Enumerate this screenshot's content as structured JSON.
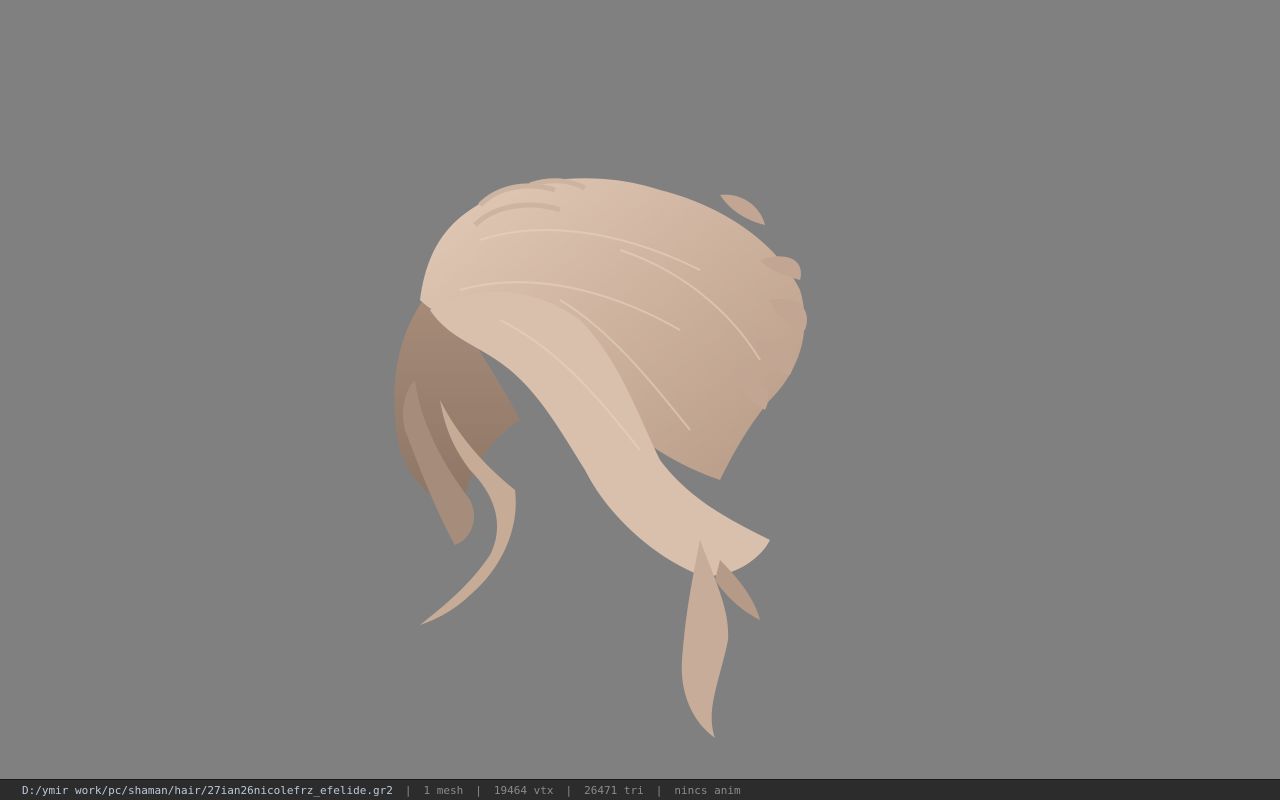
{
  "viewer": {
    "background_color": "#808080",
    "model_name": "hair-mesh",
    "hair_color": "#d4bba6"
  },
  "status": {
    "path": "D:/ymir work/pc/shaman/hair/27ian26nicolefrz_efelide.gr2",
    "separator": "|",
    "mesh_count": "1 mesh",
    "vertex_count": "19464 vtx",
    "triangle_count": "26471 tri",
    "animation": "nincs anim"
  }
}
